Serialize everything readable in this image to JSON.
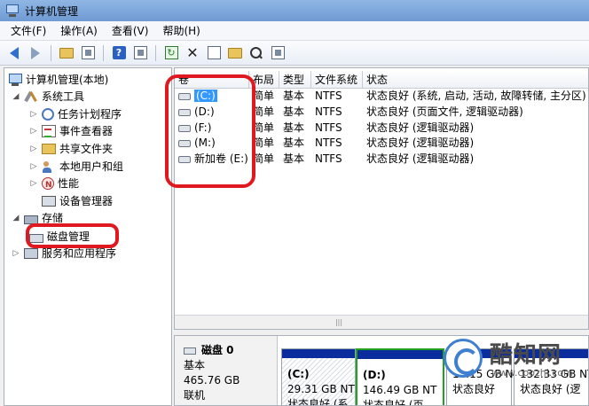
{
  "window": {
    "title": "计算机管理"
  },
  "menu": {
    "items": [
      "文件(F)",
      "操作(A)",
      "查看(V)",
      "帮助(H)"
    ]
  },
  "toolbar": {
    "icons": [
      "back-arrow-icon",
      "forward-arrow-icon",
      "up-folder-icon",
      "show-hide-tree-icon",
      "help-icon",
      "properties-icon",
      "refresh-icon",
      "delete-icon",
      "open-icon",
      "folder-icon",
      "search-icon",
      "rescan-icon"
    ]
  },
  "tree": {
    "root": "计算机管理(本地)",
    "system_tools": "系统工具",
    "task_scheduler": "任务计划程序",
    "event_viewer": "事件查看器",
    "shared_folders": "共享文件夹",
    "local_users": "本地用户和组",
    "performance": "性能",
    "device_manager": "设备管理器",
    "storage": "存储",
    "disk_management": "磁盘管理",
    "services": "服务和应用程序"
  },
  "volumes": {
    "columns": [
      "卷",
      "布局",
      "类型",
      "文件系统",
      "状态"
    ],
    "rows": [
      {
        "name": "(C:)",
        "layout": "简单",
        "type": "基本",
        "fs": "NTFS",
        "status": "状态良好 (系统, 启动, 活动, 故障转储, 主分区)"
      },
      {
        "name": "(D:)",
        "layout": "简单",
        "type": "基本",
        "fs": "NTFS",
        "status": "状态良好 (页面文件, 逻辑驱动器)"
      },
      {
        "name": "(F:)",
        "layout": "简单",
        "type": "基本",
        "fs": "NTFS",
        "status": "状态良好 (逻辑驱动器)"
      },
      {
        "name": "(M:)",
        "layout": "简单",
        "type": "基本",
        "fs": "NTFS",
        "status": "状态良好 (逻辑驱动器)"
      },
      {
        "name": "新加卷 (E:)",
        "layout": "简单",
        "type": "基本",
        "fs": "NTFS",
        "status": "状态良好 (逻辑驱动器)"
      }
    ]
  },
  "disk": {
    "name": "磁盘 0",
    "type": "基本",
    "size": "465.76 GB",
    "state": "联机",
    "partitions": [
      {
        "label": "(C:)",
        "size": "29.31 GB NT",
        "status": "状态良好 (系"
      },
      {
        "label": "(D:)",
        "size": "146.49 GB NT",
        "status": "状态良好 (页"
      },
      {
        "label": "",
        "size": "14.15 GB N",
        "status": "状态良好"
      },
      {
        "label": "",
        "size": "132.33 GB NT",
        "status": "状态良好 (逻"
      }
    ]
  },
  "watermark": {
    "brand": "酷知网",
    "url": "www.coozhi.com"
  },
  "colors": {
    "annotation": "#e0181f",
    "partition_bar": "#0a2c9c",
    "selected": "#3399ff"
  }
}
